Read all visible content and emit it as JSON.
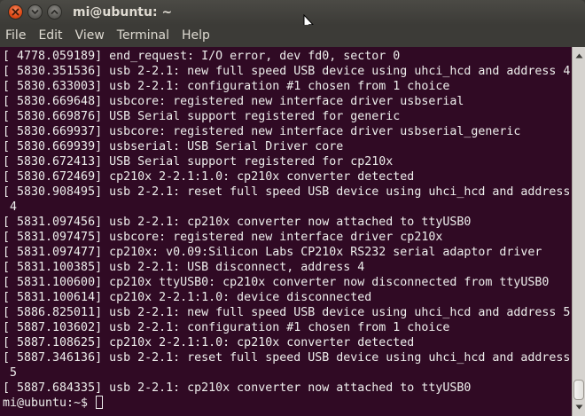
{
  "window": {
    "title": "mi@ubuntu: ~"
  },
  "menu": {
    "items": [
      "File",
      "Edit",
      "View",
      "Terminal",
      "Help"
    ]
  },
  "terminal": {
    "lines": [
      "[ 4778.059189] end_request: I/O error, dev fd0, sector 0",
      "[ 5830.351536] usb 2-2.1: new full speed USB device using uhci_hcd and address 4",
      "[ 5830.633003] usb 2-2.1: configuration #1 chosen from 1 choice",
      "[ 5830.669648] usbcore: registered new interface driver usbserial",
      "[ 5830.669876] USB Serial support registered for generic",
      "[ 5830.669937] usbcore: registered new interface driver usbserial_generic",
      "[ 5830.669939] usbserial: USB Serial Driver core",
      "[ 5830.672413] USB Serial support registered for cp210x",
      "[ 5830.672469] cp210x 2-2.1:1.0: cp210x converter detected",
      "[ 5830.908495] usb 2-2.1: reset full speed USB device using uhci_hcd and address",
      " 4",
      "[ 5831.097456] usb 2-2.1: cp210x converter now attached to ttyUSB0",
      "[ 5831.097475] usbcore: registered new interface driver cp210x",
      "[ 5831.097477] cp210x: v0.09:Silicon Labs CP210x RS232 serial adaptor driver",
      "[ 5831.100385] usb 2-2.1: USB disconnect, address 4",
      "[ 5831.100600] cp210x ttyUSB0: cp210x converter now disconnected from ttyUSB0",
      "[ 5831.100614] cp210x 2-2.1:1.0: device disconnected",
      "[ 5886.825011] usb 2-2.1: new full speed USB device using uhci_hcd and address 5",
      "[ 5887.103602] usb 2-2.1: configuration #1 chosen from 1 choice",
      "[ 5887.108625] cp210x 2-2.1:1.0: cp210x converter detected",
      "[ 5887.346136] usb 2-2.1: reset full speed USB device using uhci_hcd and address",
      " 5",
      "[ 5887.684335] usb 2-2.1: cp210x converter now attached to ttyUSB0"
    ],
    "prompt": "mi@ubuntu:~$ "
  },
  "scrollbar": {
    "thumb_start": 0.94,
    "thumb_size": 0.06
  },
  "colors": {
    "terminal_bg": "#300a24",
    "terminal_fg": "#eeeeec",
    "titlebar_bg": "#3c3b37",
    "close_button": "#df4a16"
  },
  "icons": {
    "close": "close-icon",
    "minimize": "minimize-icon",
    "maximize": "maximize-icon",
    "mouse_pointer": "mouse-pointer-icon"
  }
}
